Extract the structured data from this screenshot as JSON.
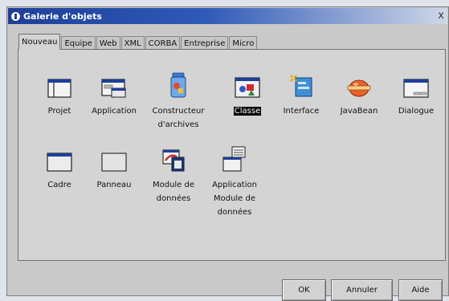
{
  "window": {
    "title": "Galerie d'objets",
    "close_glyph": "x"
  },
  "tabs": [
    {
      "label": "Nouveau",
      "active": true
    },
    {
      "label": "Equipe",
      "active": false
    },
    {
      "label": "Web",
      "active": false
    },
    {
      "label": "XML",
      "active": false
    },
    {
      "label": "CORBA",
      "active": false
    },
    {
      "label": "Entreprise",
      "active": false
    },
    {
      "label": "Micro",
      "active": false
    }
  ],
  "items": {
    "projet": {
      "line1": "Projet",
      "icon": "project-window-icon"
    },
    "application": {
      "line1": "Application",
      "icon": "application-window-icon"
    },
    "constructeur": {
      "line1": "Constructeur",
      "line2": "d'archives",
      "icon": "archive-jar-icon"
    },
    "classe": {
      "line1": "Classe",
      "icon": "class-shapes-icon",
      "selected": true
    },
    "interface": {
      "line1": "Interface",
      "icon": "interface-icon"
    },
    "javabean": {
      "line1": "JavaBean",
      "icon": "javabean-icon"
    },
    "dialogue": {
      "line1": "Dialogue",
      "icon": "dialog-window-icon"
    },
    "cadre": {
      "line1": "Cadre",
      "icon": "frame-window-icon"
    },
    "panneau": {
      "line1": "Panneau",
      "icon": "panel-icon"
    },
    "module": {
      "line1": "Module de",
      "line2": "données",
      "icon": "data-module-icon"
    },
    "appmodule": {
      "line1": "Application",
      "line2": "Module de",
      "line3": "données",
      "icon": "data-module-application-icon"
    }
  },
  "buttons": {
    "ok": "OK",
    "cancel": "Annuler",
    "help": "Aide"
  },
  "colors": {
    "titlebar": "#1d3f99",
    "selection": "#000000",
    "dialog_bg": "#d4d4d4"
  }
}
